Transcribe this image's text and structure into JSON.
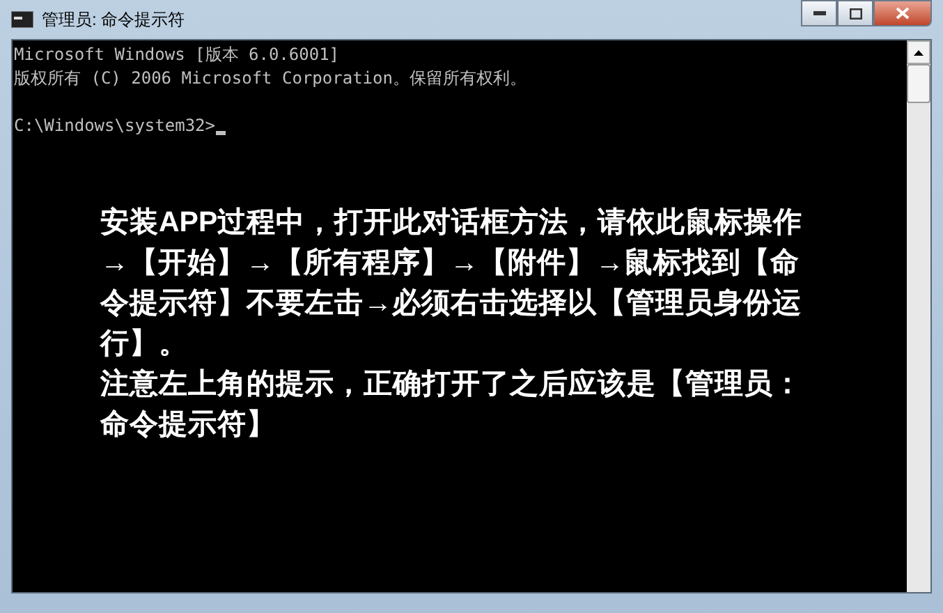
{
  "window": {
    "title": "管理员: 命令提示符"
  },
  "console": {
    "output": [
      "Microsoft Windows [版本 6.0.6001]",
      "版权所有 (C) 2006 Microsoft Corporation。保留所有权利。"
    ],
    "prompt": "C:\\Windows\\system32>",
    "cursor": true
  },
  "annotation": {
    "paragraphs": [
      "安装APP过程中，打开此对话框方法，请依此鼠标操作→【开始】→【所有程序】→【附件】→鼠标找到【命令提示符】不要左击→必须右击选择以【管理员身份运行】。",
      "注意左上角的提示，正确打开了之后应该是【管理员：命令提示符】"
    ]
  }
}
